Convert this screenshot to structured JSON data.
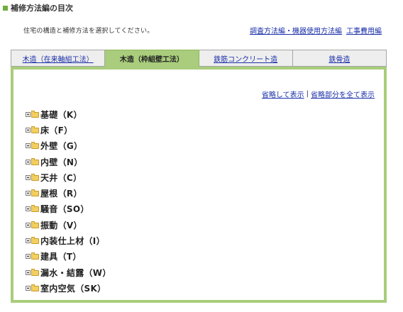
{
  "heading": "補修方法編の目次",
  "intro": "住宅の構造と補修方法を選択してください。",
  "top_links": [
    {
      "label": "調査方法編・機器使用方法編"
    },
    {
      "label": "工事費用編"
    }
  ],
  "tabs": [
    {
      "label": "木造（在来軸組工法）",
      "active": false
    },
    {
      "label": "木造（枠組壁工法）",
      "active": true
    },
    {
      "label": "鉄筋コンクリート造",
      "active": false
    },
    {
      "label": "鉄骨造",
      "active": false
    }
  ],
  "toggle_links": {
    "collapse": "省略して表示",
    "separator": "|",
    "expand_all": "省略部分を全て表示"
  },
  "tree": [
    {
      "label": "基礎（K）"
    },
    {
      "label": "床（F）"
    },
    {
      "label": "外壁（G）"
    },
    {
      "label": "内壁（N）"
    },
    {
      "label": "天井（C）"
    },
    {
      "label": "屋根（R）"
    },
    {
      "label": "騒音（SO）"
    },
    {
      "label": "振動（V）"
    },
    {
      "label": "内装仕上材（I）"
    },
    {
      "label": "建具（T）"
    },
    {
      "label": "漏水・結露（W）"
    },
    {
      "label": "室内空気（SK）"
    }
  ],
  "colors": {
    "accent_green": "#a9cd7c",
    "link_blue": "#1a2fa8",
    "folder_yellow": "#f2cf61"
  },
  "icons": [
    "square-bullet-icon",
    "plus-box-icon",
    "folder-icon"
  ]
}
